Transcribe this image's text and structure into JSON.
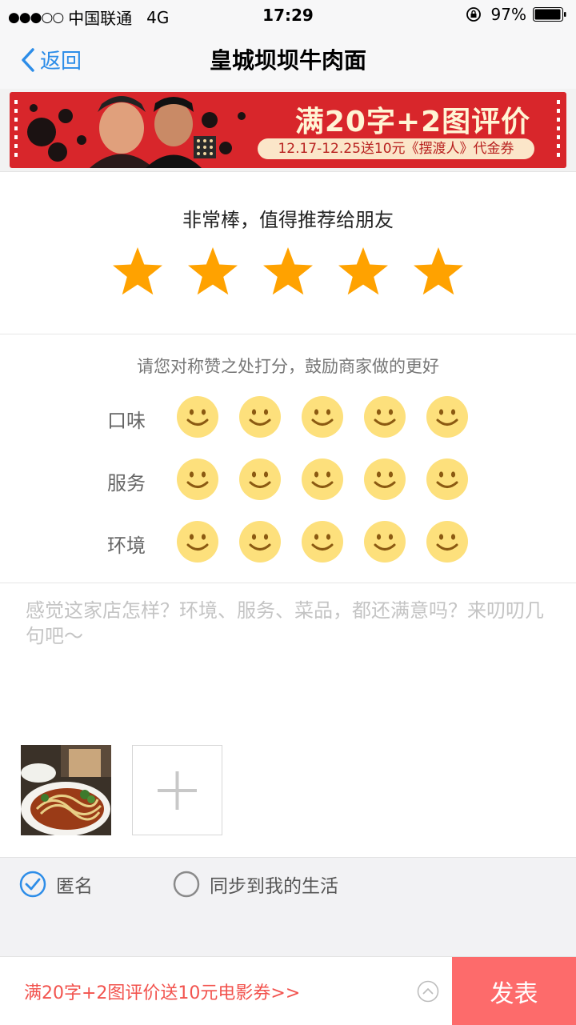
{
  "status_bar": {
    "signal": "●●●○○",
    "carrier": "中国联通",
    "network": "4G",
    "time": "17:29",
    "battery": "97%"
  },
  "nav": {
    "back_label": "返回",
    "title": "皇城坝坝牛肉面"
  },
  "banner": {
    "title": "满20字+2图评价",
    "subtitle": "12.17-12.25送10元《摆渡人》代金券"
  },
  "rating": {
    "text": "非常棒，值得推荐给朋友",
    "stars": 5,
    "star_color": "#ffa200"
  },
  "sub_ratings": {
    "hint": "请您对称赞之处打分，鼓励商家做的更好",
    "rows": [
      {
        "label": "口味",
        "score": 5
      },
      {
        "label": "服务",
        "score": 5
      },
      {
        "label": "环境",
        "score": 5
      }
    ],
    "face_color": "#fde07c"
  },
  "comment": {
    "placeholder": "感觉这家店怎样？环境、服务、菜品，都还满意吗？来叨叨几句吧～",
    "value": ""
  },
  "photos": {
    "count": 1,
    "add_icon": "plus-icon"
  },
  "options": {
    "anonymous": {
      "label": "匿名",
      "checked": true
    },
    "sync": {
      "label": "同步到我的生活",
      "checked": false
    }
  },
  "bottom": {
    "promo": "满20字+2图评价送10元电影券>>",
    "submit": "发表",
    "accent": "#fd6b6b"
  }
}
